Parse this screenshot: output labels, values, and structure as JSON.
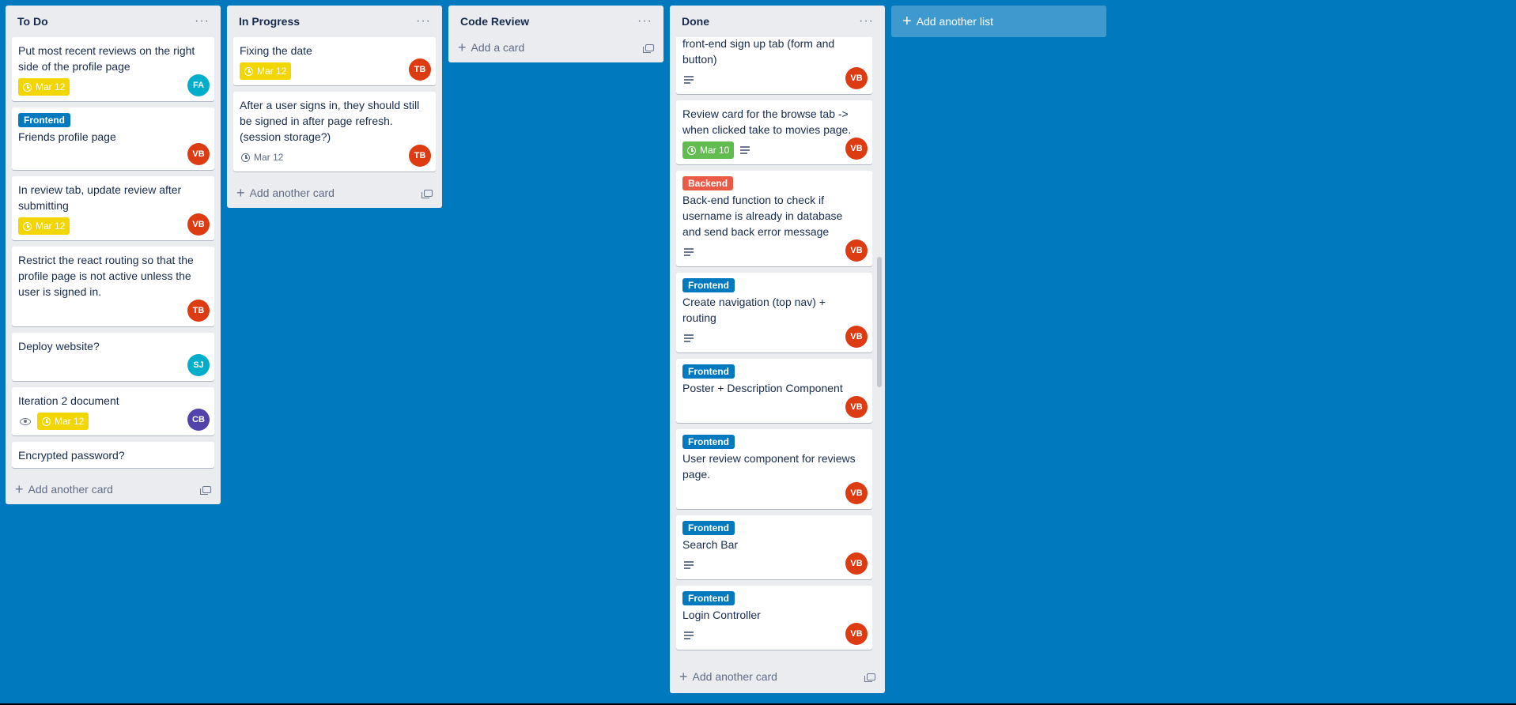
{
  "board": {
    "add_list_label": "Add another list"
  },
  "colors": {
    "board_bg": "#0079bf",
    "label_frontend": "#0079bf",
    "label_backend": "#eb5a46",
    "due_yellow": "#f2d600",
    "due_green": "#61bd4f",
    "avatar_FA": "#00aecc",
    "avatar_VB": "#dd3b12",
    "avatar_TB": "#dd3b12",
    "avatar_SJ": "#00aecc",
    "avatar_CB": "#5243aa"
  },
  "lists": [
    {
      "title": "To Do",
      "menu": "···",
      "add_label": "Add another card",
      "cards": [
        {
          "title": "Put most recent reviews on the right side of the profile page",
          "due": "Mar 12",
          "avatar": "FA"
        },
        {
          "label": "Frontend",
          "title": "Friends profile page",
          "avatar": "VB"
        },
        {
          "title": "In review tab, update review after submitting",
          "due": "Mar 12",
          "avatar": "VB"
        },
        {
          "title": "Restrict the react routing so that the profile page is not active unless the user is signed in.",
          "avatar": "TB"
        },
        {
          "title": "Deploy website?",
          "avatar": "SJ"
        },
        {
          "title": "Iteration 2 document",
          "due": "Mar 12",
          "avatar": "CB"
        },
        {
          "title": "Encrypted password?"
        }
      ]
    },
    {
      "title": "In Progress",
      "menu": "···",
      "add_label": "Add another card",
      "cards": [
        {
          "title": "Fixing the date",
          "due": "Mar 12",
          "avatar": "TB"
        },
        {
          "title": "After a user signs in, they should still be signed in after page refresh. (session storage?)",
          "due": "Mar 12",
          "avatar": "TB"
        }
      ]
    },
    {
      "title": "Code Review",
      "menu": "···",
      "add_label": "Add a card",
      "cards": []
    },
    {
      "title": "Done",
      "menu": "···",
      "add_label": "Add another card",
      "cards": [
        {
          "title": "front-end sign up tab (form and button)",
          "avatar": "VB"
        },
        {
          "title": "Review card for the browse tab -> when clicked take to movies page.",
          "due": "Mar 10",
          "avatar": "VB"
        },
        {
          "label": "Backend",
          "title": "Back-end function to check if username is already in database and send back error message",
          "avatar": "VB"
        },
        {
          "label": "Frontend",
          "title": "Create navigation (top nav) + routing",
          "avatar": "VB"
        },
        {
          "label": "Frontend",
          "title": "Poster + Description Component",
          "avatar": "VB"
        },
        {
          "label": "Frontend",
          "title": "User review component for reviews page.",
          "avatar": "VB"
        },
        {
          "label": "Frontend",
          "title": "Search Bar",
          "avatar": "VB"
        },
        {
          "label": "Frontend",
          "title": "Login Controller",
          "avatar": "VB"
        }
      ]
    }
  ]
}
